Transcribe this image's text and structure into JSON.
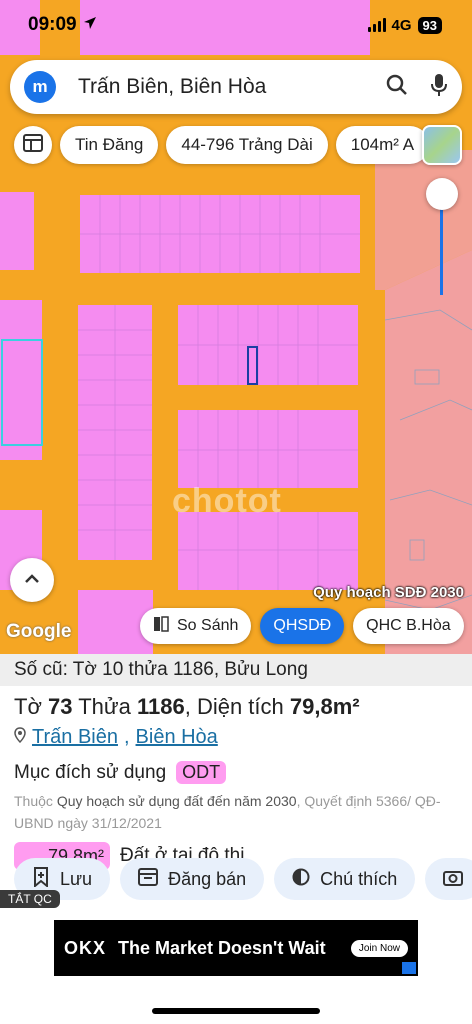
{
  "status_bar": {
    "time": "09:09",
    "network": "4G",
    "battery": "93"
  },
  "search": {
    "avatar_letter": "m",
    "query": "Trấn Biên, Biên Hòa"
  },
  "chips": [
    {
      "label": "Tin Đăng"
    },
    {
      "label": "44-796 Trảng Dài"
    },
    {
      "label": "104m² A"
    }
  ],
  "map": {
    "legend_label": "Quy hoạch SDĐ 2030",
    "google_logo": "Google",
    "watermark": "chotot",
    "buttons": [
      {
        "label": "So Sánh",
        "active": false
      },
      {
        "label": "QHSDĐ",
        "active": true
      },
      {
        "label": "QHC B.Hòa",
        "active": false
      }
    ],
    "colors": {
      "road": "#f5a623",
      "residential": "#f58cf0",
      "commercial": "#f2a0a0"
    }
  },
  "parcel": {
    "old_info": "Số cũ: Tờ 10 thửa 1186, Bửu Long",
    "sheet_label": "Tờ",
    "sheet": "73",
    "plot_label": "Thửa",
    "plot": "1186",
    "area_label": "Diện tích",
    "area": "79,8m²",
    "location_ward": "Trấn Biên",
    "location_city": "Biên Hòa",
    "purpose_label": "Mục đích sử dụng",
    "purpose_code": "ODT",
    "note_prefix": "Thuộc",
    "note_plan": "Quy hoạch sử dụng đất đến năm 2030",
    "note_suffix": ", Quyết định 5366/ QĐ-UBND ngày 31/12/2021",
    "land_area": "79,8m²",
    "land_type": "Đất ở tại đô thị"
  },
  "actions": [
    {
      "label": "Lưu"
    },
    {
      "label": "Đăng bán"
    },
    {
      "label": "Chú thích"
    }
  ],
  "ad": {
    "tag": "TẮT QC",
    "logo": "OKX",
    "text": "The Market Doesn't Wait",
    "button": "Join Now"
  }
}
